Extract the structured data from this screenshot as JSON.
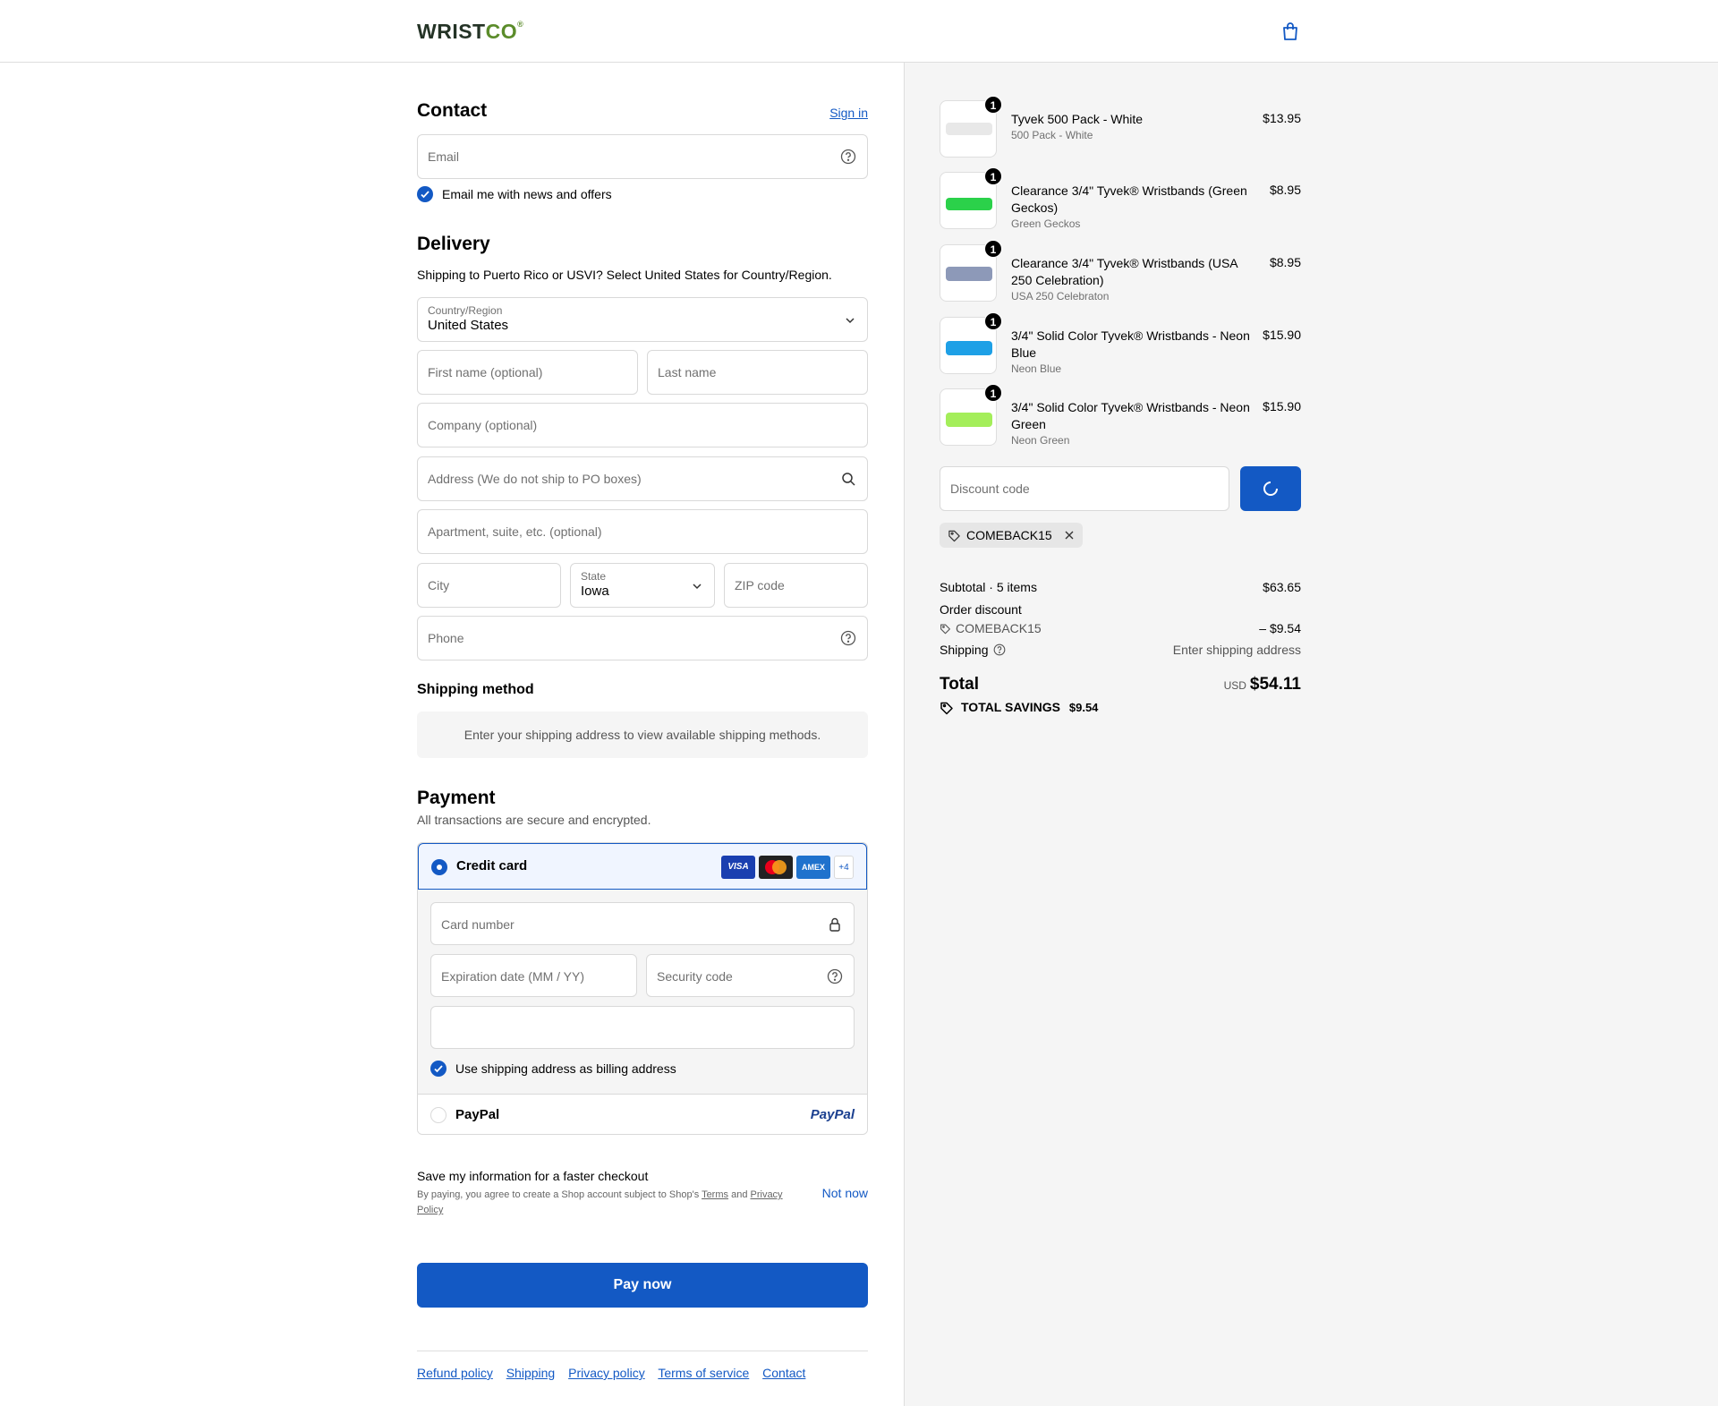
{
  "header": {
    "logo_main": "WRIST",
    "logo_accent": "CO",
    "logo_mark": "®",
    "cart_icon": "shopping-bag-icon"
  },
  "contact": {
    "title": "Contact",
    "sign_in": "Sign in",
    "email_placeholder": "Email",
    "news_label": "Email me with news and offers"
  },
  "delivery": {
    "title": "Delivery",
    "notice": "Shipping to Puerto Rico or USVI? Select United States for Country/Region.",
    "country_label": "Country/Region",
    "country_value": "United States",
    "first_name": "First name (optional)",
    "last_name": "Last name",
    "company": "Company (optional)",
    "address": "Address (We do not ship to PO boxes)",
    "apartment": "Apartment, suite, etc. (optional)",
    "city": "City",
    "state_label": "State",
    "state_value": "Iowa",
    "zip": "ZIP code",
    "phone": "Phone"
  },
  "shipping_method": {
    "title": "Shipping method",
    "message": "Enter your shipping address to view available shipping methods."
  },
  "payment": {
    "title": "Payment",
    "subtitle": "All transactions are secure and encrypted.",
    "credit_card": "Credit card",
    "cards": {
      "visa": "VISA",
      "amex": "AMEX",
      "more": "+4"
    },
    "card_number": "Card number",
    "expiration": "Expiration date (MM / YY)",
    "security_code": "Security code",
    "billing_label": "Use shipping address as billing address",
    "paypal": "PayPal",
    "paypal_logo": "PayPal"
  },
  "save_info": {
    "title": "Save my information for a faster checkout",
    "text_before": "By paying, you agree to create a Shop account subject to Shop's",
    "terms": "Terms",
    "and": "and",
    "privacy": "Privacy Policy",
    "not_now": "Not now"
  },
  "pay_button": "Pay now",
  "footer_links": [
    "Refund policy",
    "Shipping",
    "Privacy policy",
    "Terms of service",
    "Contact"
  ],
  "items": [
    {
      "qty": "1",
      "name": "Tyvek 500 Pack - White",
      "variant": "500 Pack - White",
      "price": "$13.95",
      "color": "#e8e8e8"
    },
    {
      "qty": "1",
      "name": "Clearance 3/4\" Tyvek® Wristbands (Green Geckos)",
      "variant": "Green Geckos",
      "price": "$8.95",
      "color": "#2bd14a"
    },
    {
      "qty": "1",
      "name": "Clearance 3/4\" Tyvek® Wristbands (USA 250 Celebration)",
      "variant": "USA 250 Celebraton",
      "price": "$8.95",
      "color": "#8d99b8"
    },
    {
      "qty": "1",
      "name": "3/4\" Solid Color Tyvek® Wristbands - Neon Blue",
      "variant": "Neon Blue",
      "price": "$15.90",
      "color": "#1ea0e6"
    },
    {
      "qty": "1",
      "name": "3/4\" Solid Color Tyvek® Wristbands - Neon Green",
      "variant": "Neon Green",
      "price": "$15.90",
      "color": "#a4ee5a"
    }
  ],
  "discount": {
    "placeholder": "Discount code",
    "applied_code": "COMEBACK15"
  },
  "totals": {
    "subtotal_label": "Subtotal · 5 items",
    "subtotal": "$63.65",
    "order_discount_label": "Order discount",
    "discount_code": "COMEBACK15",
    "discount_value": "– $9.54",
    "shipping_label": "Shipping",
    "shipping_value": "Enter shipping address",
    "total_label": "Total",
    "currency": "USD",
    "total": "$54.11",
    "savings_label": "TOTAL SAVINGS",
    "savings_value": "$9.54"
  },
  "colors": {
    "accent": "#1359c4",
    "panel": "#f5f5f5",
    "border": "#d9d9d9"
  }
}
